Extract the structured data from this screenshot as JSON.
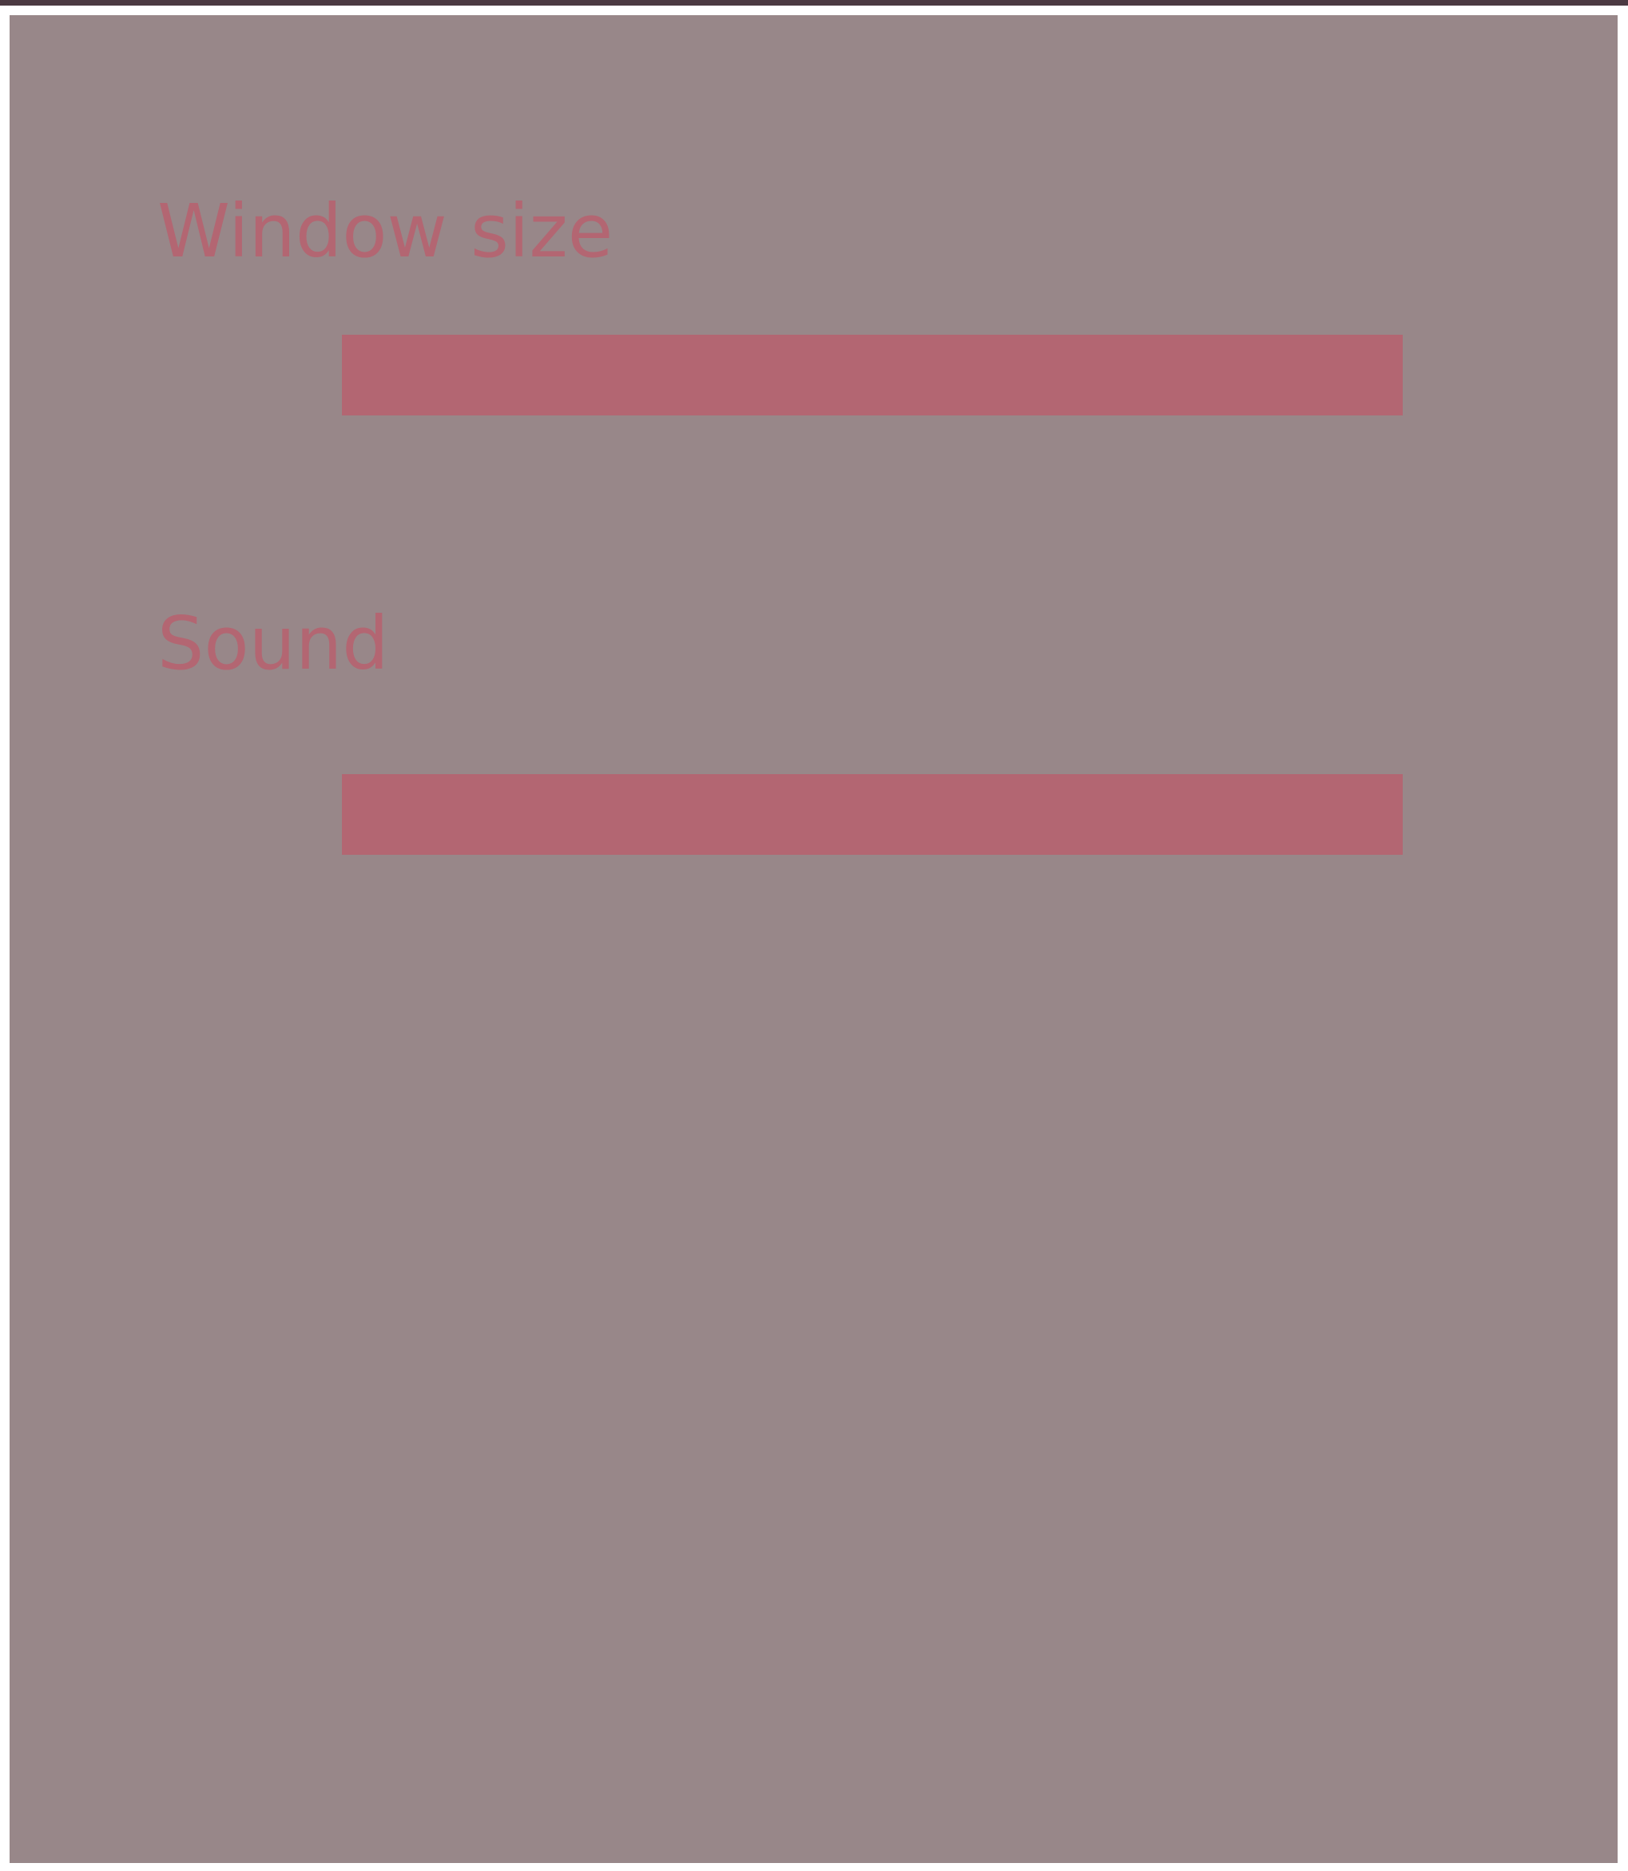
{
  "settings": {
    "window_size": {
      "label": "Window size"
    },
    "sound": {
      "label": "Sound"
    }
  },
  "colors": {
    "panel_background": "#988789",
    "accent": "#b36672",
    "top_border": "#4b3a42"
  }
}
